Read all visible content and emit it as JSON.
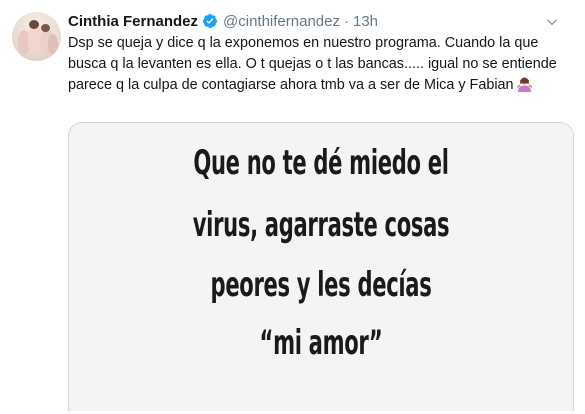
{
  "tweet": {
    "author_name": "Cinthia Fernandez",
    "handle": "@cinthifernandez",
    "separator": "·",
    "time": "13h",
    "text": "Dsp se queja y dice q la exponemos en nuestro programa. Cuando la que busca q la levanten es ella. O t quejas o t las bancas..... igual no se entiende parece q la culpa de contagiarse ahora tmb va a ser de Mica y Fabian",
    "trailing_emoji": "woman-shrugging-emoji",
    "verified_icon": "verified-badge-icon",
    "menu_icon": "chevron-down-icon"
  },
  "media": {
    "lines": [
      "Que no te dé miedo el",
      "virus, agarraste cosas",
      "peores  y les decías",
      "“mi amor”"
    ]
  },
  "colors": {
    "verified": "#1da1f2",
    "secondary_text": "#657786",
    "primary_text": "#14171a",
    "border": "#ccd6dd"
  }
}
